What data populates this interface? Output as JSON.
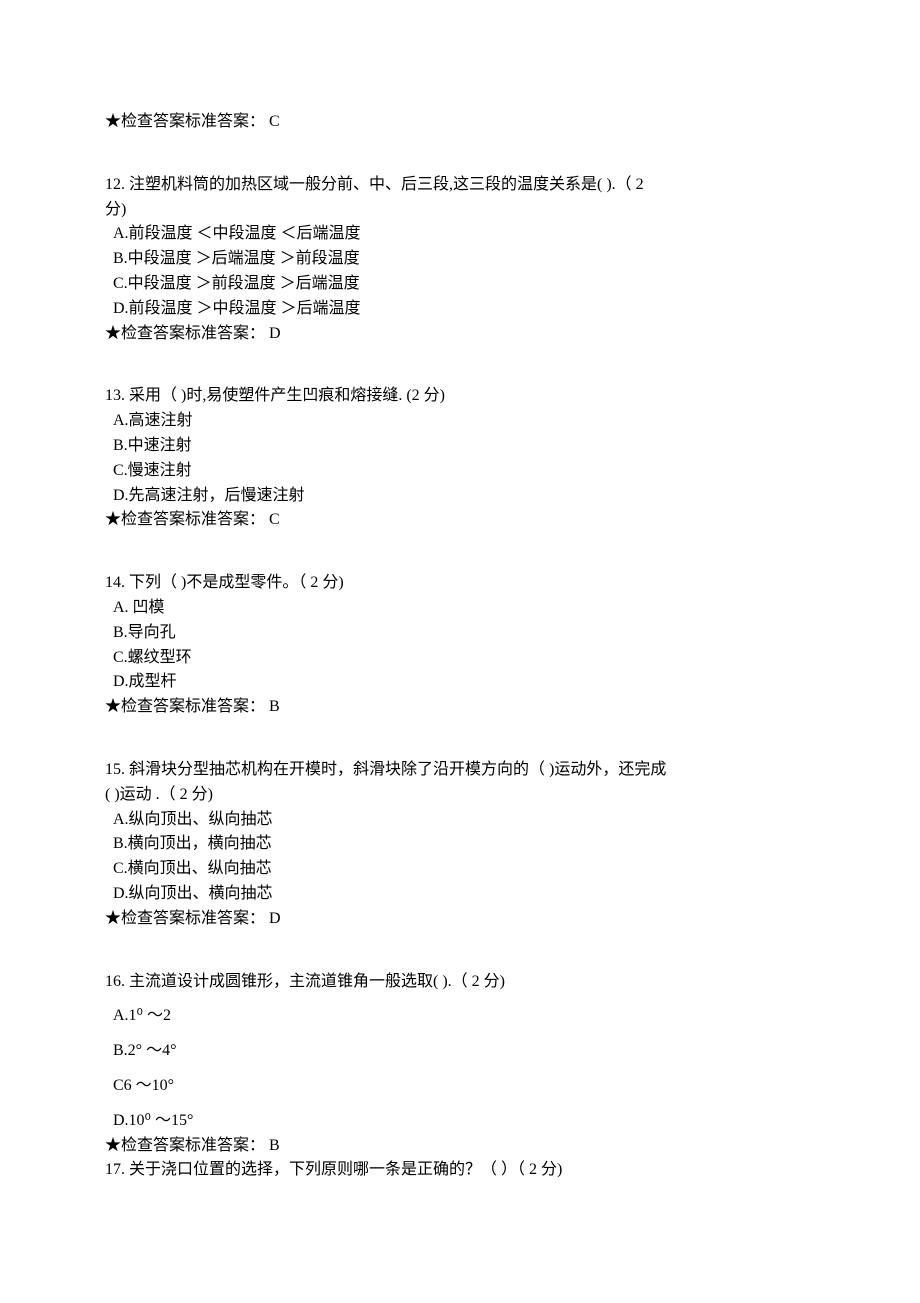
{
  "q11": {
    "answer_line": "★检查答案标准答案： C"
  },
  "q12": {
    "stem_l1": "12. 注塑机料筒的加热区域一般分前、中、后三段,这三段的温度关系是( ).（ 2",
    "stem_l2": "分)",
    "optA": " A.前段温度 ＜中段温度 ＜后端温度",
    "optB": " B.中段温度 ＞后端温度 ＞前段温度",
    "optC": " C.中段温度 ＞前段温度 ＞后端温度",
    "optD": " D.前段温度 ＞中段温度 ＞后端温度",
    "answer_line": "★检查答案标准答案： D"
  },
  "q13": {
    "stem": "13. 采用（ )时,易使塑件产生凹痕和熔接缝. (2 分)",
    "optA": " A.高速注射",
    "optB": " B.中速注射",
    "optC": " C.慢速注射",
    "optD": " D.先高速注射，后慢速注射",
    "answer_line": "★检查答案标准答案： C"
  },
  "q14": {
    "stem": "14. 下列（ )不是成型零件。（ 2 分)",
    "optA": " A. 凹模",
    "optB": " B.导向孔",
    "optC": " C.螺纹型环",
    "optD": " D.成型杆",
    "answer_line": "★检查答案标准答案： B"
  },
  "q15": {
    "stem_l1": "15. 斜滑块分型抽芯机构在开模时，斜滑块除了沿开模方向的（ )运动外，还完成",
    "stem_l2": "( )运动 .（ 2 分)",
    "optA": " A.纵向顶出、纵向抽芯",
    "optB": " B.横向顶出，横向抽芯",
    "optC": " C.横向顶出、纵向抽芯",
    "optD": " D.纵向顶出、横向抽芯",
    "answer_line": "★检查答案标准答案： D"
  },
  "q16": {
    "stem": "16. 主流道设计成圆锥形，主流道锥角一般选取( ).（ 2 分)",
    "optA": " A.1⁰ 〜2",
    "optB": " B.2° 〜4°",
    "optC": " C6 〜10°",
    "optD": " D.10⁰ 〜15°",
    "answer_line": "★检查答案标准答案： B"
  },
  "q17": {
    "stem": "17. 关于浇口位置的选择，下列原则哪一条是正确的？（ ）（ 2 分)"
  }
}
